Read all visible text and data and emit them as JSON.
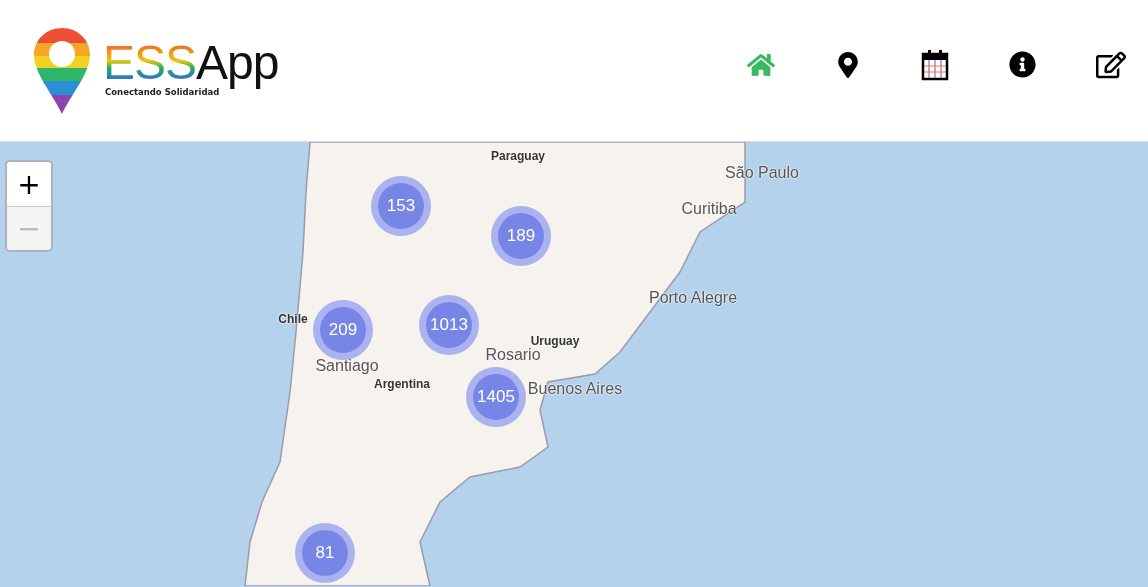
{
  "logo": {
    "brand_colored": "ESS",
    "brand_plain": "App",
    "tagline": "Conectando Solidaridad"
  },
  "nav": [
    {
      "kind": "home",
      "selected": true
    },
    {
      "kind": "pin",
      "selected": false
    },
    {
      "kind": "calendar",
      "selected": false
    },
    {
      "kind": "info",
      "selected": false
    },
    {
      "kind": "edit",
      "selected": false
    }
  ],
  "zoom_controls": [
    {
      "label": "+",
      "disabled": false
    },
    {
      "label": "−",
      "disabled": true
    }
  ],
  "map_labels": [
    {
      "text": "Paraguay",
      "kind": "country"
    },
    {
      "text": "São Paulo",
      "kind": "city"
    },
    {
      "text": "Curitiba",
      "kind": "city"
    },
    {
      "text": "Porto Alegre",
      "kind": "city"
    },
    {
      "text": "Chile",
      "kind": "country"
    },
    {
      "text": "Santiago",
      "kind": "city"
    },
    {
      "text": "Argentina",
      "kind": "country"
    },
    {
      "text": "Uruguay",
      "kind": "country"
    },
    {
      "text": "Rosario",
      "kind": "city"
    },
    {
      "text": "Buenos Aires",
      "kind": "city"
    }
  ],
  "clusters": [
    {
      "count": "153"
    },
    {
      "count": "189"
    },
    {
      "count": "209"
    },
    {
      "count": "1013"
    },
    {
      "count": "1405"
    },
    {
      "count": "81"
    }
  ]
}
